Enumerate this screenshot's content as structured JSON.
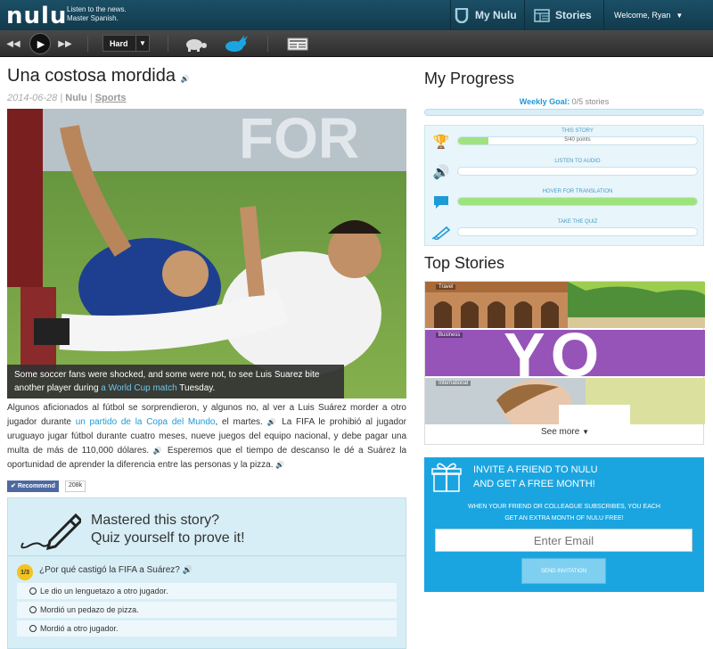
{
  "header": {
    "logo": "nulu",
    "tagline_1": "Listen to the news.",
    "tagline_2": "Master Spanish.",
    "nav_mynulu": "My Nulu",
    "nav_stories": "Stories",
    "welcome": "Welcome, Ryan"
  },
  "toolbar": {
    "difficulty": "Hard",
    "icons": [
      "rewind-icon",
      "play-icon",
      "fast-forward-icon",
      "turtle-slow-icon",
      "rabbit-fast-icon",
      "translation-card-icon"
    ]
  },
  "article": {
    "title": "Una costosa mordida",
    "date": "2014-06-28",
    "source": "Nulu",
    "category": "Sports",
    "caption_pre": "Some soccer fans were shocked, and some were not, to see Luis Suarez bite another player during ",
    "caption_link": "a World Cup match",
    "caption_post": " Tuesday.",
    "p1": "Algunos aficionados al fútbol se sorprendieron, y algunos no, al ver a Luis Suárez morder a otro jugador durante ",
    "p1_link": "un partido de la Copa del Mundo",
    "p1_end": ", el martes.",
    "p2": " La FIFA le prohibió al jugador uruguayo jugar fútbol durante cuatro meses, nueve juegos del equipo nacional, y debe pagar una multa de más de 110,000 dólares.",
    "p3": " Esperemos que el tiempo de descanso le dé a Suárez la oportunidad de aprender la diferencia entre las personas y la pizza.",
    "recommend_label": "Recommend",
    "recommend_count": "208k"
  },
  "quiz": {
    "heading_1": "Mastered this story?",
    "heading_2": "Quiz yourself to prove it!",
    "question_number": "1/3",
    "question": "¿Por qué castigó la FIFA a Suárez?",
    "options": [
      "Le dio un lenguetazo a otro jugador.",
      "Mordió un pedazo de pizza.",
      "Mordió a otro jugador."
    ]
  },
  "progress": {
    "title": "My Progress",
    "weekly_goal_label": "Weekly Goal:",
    "weekly_goal_value": "0/5 stories",
    "weekly_goal_fraction": 0,
    "rows": [
      {
        "label": "THIS STORY",
        "sub": "5/40 points",
        "fill": 0.125,
        "icon": "trophy-icon"
      },
      {
        "label": "LISTEN TO AUDIO",
        "sub": "",
        "fill": 0,
        "icon": "speaker-icon"
      },
      {
        "label": "HOVER FOR TRANSLATION",
        "sub": "",
        "fill": 1,
        "icon": "speech-bubble-icon"
      },
      {
        "label": "TAKE THE QUIZ",
        "sub": "",
        "fill": 0,
        "icon": "pencil-icon"
      }
    ]
  },
  "top_stories": {
    "title": "Top Stories",
    "items": [
      {
        "tag": "Travel"
      },
      {
        "tag": "Business",
        "overlay": "YO"
      },
      {
        "tag": "International"
      }
    ],
    "see_more": "See more"
  },
  "invite": {
    "title_1": "INVITE A FRIEND TO NULU",
    "title_2": "AND GET A FREE MONTH!",
    "sub_1": "WHEN YOUR FRIEND OR COLLEAGUE SUBSCRIBES, YOU EACH",
    "sub_2": "GET AN EXTRA MONTH OF NULU FREE!",
    "email_placeholder": "Enter Email",
    "send_label": "SEND INVITATION"
  }
}
